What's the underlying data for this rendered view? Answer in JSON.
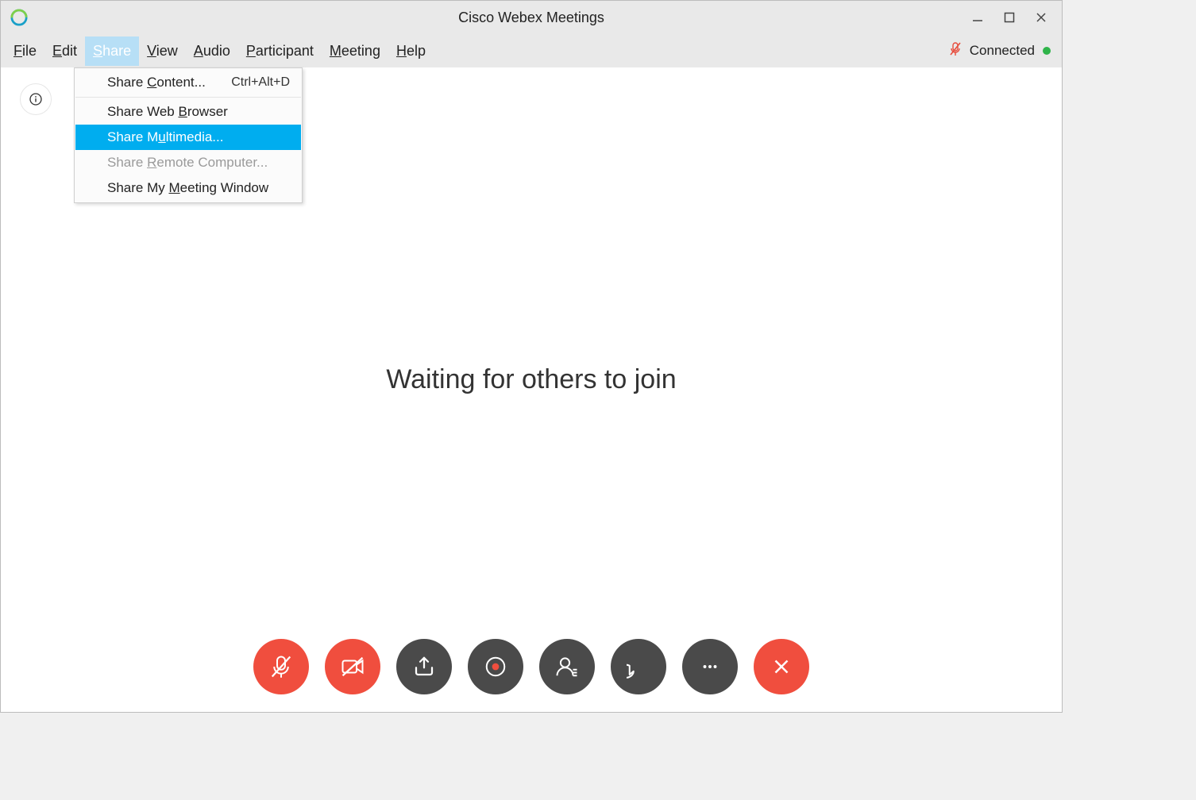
{
  "title": "Cisco Webex Meetings",
  "menubar": {
    "file": "File",
    "edit": "Edit",
    "share": "Share",
    "view": "View",
    "audio": "Audio",
    "participant": "Participant",
    "meeting": "Meeting",
    "help": "Help"
  },
  "status": {
    "label": "Connected",
    "color": "#2fb44a"
  },
  "share_menu": {
    "share_content": "Share Content...",
    "share_content_shortcut": "Ctrl+Alt+D",
    "share_browser": "Share Web Browser",
    "share_multimedia": "Share Multimedia...",
    "share_remote": "Share Remote Computer...",
    "share_window": "Share My Meeting Window"
  },
  "main": {
    "waiting_text": "Waiting for others to join"
  },
  "dock": {
    "mute": "mute",
    "video": "video",
    "share": "share",
    "record": "record",
    "participants": "participants",
    "chat": "chat",
    "more": "more",
    "leave": "leave"
  }
}
